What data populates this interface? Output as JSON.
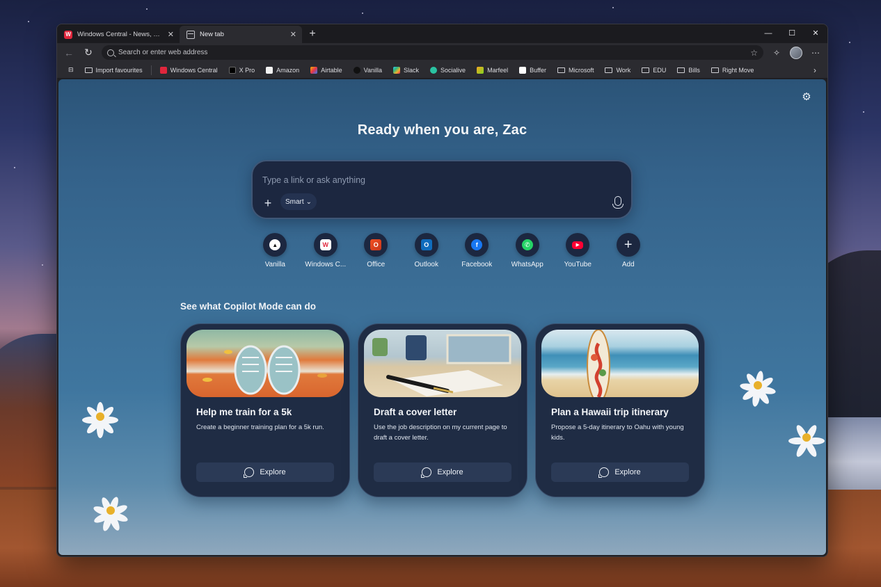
{
  "tabs": [
    {
      "title": "Windows Central - News, Reviews",
      "active": false,
      "favicon": "windows-central-icon"
    },
    {
      "title": "New tab",
      "active": true,
      "favicon": "new-tab-icon"
    }
  ],
  "address": {
    "placeholder": "Search or enter web address"
  },
  "bookmarks": [
    {
      "label": "Import favourites",
      "icon": "import-icon"
    },
    {
      "label": "Windows Central",
      "icon": "windows-central-icon",
      "color": "#e0263c"
    },
    {
      "label": "X Pro",
      "icon": "x-icon",
      "color": "#000000"
    },
    {
      "label": "Amazon",
      "icon": "amazon-icon",
      "color": "#f2f2f2"
    },
    {
      "label": "Airtable",
      "icon": "airtable-icon",
      "color": "#f4b400"
    },
    {
      "label": "Vanilla",
      "icon": "vanilla-icon",
      "color": "#111111"
    },
    {
      "label": "Slack",
      "icon": "slack-icon",
      "color": "#36c5f0"
    },
    {
      "label": "Socialive",
      "icon": "socialive-icon",
      "color": "#2ac3a2"
    },
    {
      "label": "Marfeel",
      "icon": "marfeel-icon",
      "color": "#f5a623"
    },
    {
      "label": "Buffer",
      "icon": "buffer-icon",
      "color": "#ffffff"
    },
    {
      "label": "Microsoft",
      "icon": "folder-icon"
    },
    {
      "label": "Work",
      "icon": "folder-icon"
    },
    {
      "label": "EDU",
      "icon": "folder-icon"
    },
    {
      "label": "Bills",
      "icon": "folder-icon"
    },
    {
      "label": "Right Move",
      "icon": "folder-icon"
    }
  ],
  "hero": {
    "title": "Ready when you are, Zac"
  },
  "chat": {
    "placeholder": "Type a link or ask anything",
    "mode": "Smart"
  },
  "shortcuts": [
    {
      "label": "Vanilla",
      "icon": "vanilla-icon"
    },
    {
      "label": "Windows C...",
      "icon": "windows-central-icon"
    },
    {
      "label": "Office",
      "icon": "office-icon"
    },
    {
      "label": "Outlook",
      "icon": "outlook-icon"
    },
    {
      "label": "Facebook",
      "icon": "facebook-icon"
    },
    {
      "label": "WhatsApp",
      "icon": "whatsapp-icon"
    },
    {
      "label": "YouTube",
      "icon": "youtube-icon"
    },
    {
      "label": "Add",
      "icon": "plus-icon"
    }
  ],
  "section": {
    "title": "See what Copilot Mode can do"
  },
  "cards": [
    {
      "title": "Help me train for a 5k",
      "desc": "Create a beginner training plan for a 5k run.",
      "button": "Explore"
    },
    {
      "title": "Draft a cover letter",
      "desc": "Use the job description on my current page to draft a cover letter.",
      "button": "Explore"
    },
    {
      "title": "Plan a Hawaii trip itinerary",
      "desc": "Propose a 5-day itinerary to Oahu with young kids.",
      "button": "Explore"
    }
  ],
  "colors": {
    "accent_wc": "#e0263c",
    "card_bg": "#1f2c44",
    "page_bg": "#3b6e96"
  }
}
